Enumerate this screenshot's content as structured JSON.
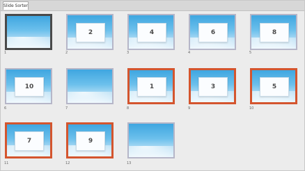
{
  "panel": {
    "tab_label": "Slide Sorter"
  },
  "slides": [
    {
      "card": "",
      "index": "1",
      "state": "selected"
    },
    {
      "card": "2",
      "index": "2",
      "state": "normal"
    },
    {
      "card": "4",
      "index": "3",
      "state": "normal"
    },
    {
      "card": "6",
      "index": "4",
      "state": "normal"
    },
    {
      "card": "8",
      "index": "5",
      "state": "normal"
    },
    {
      "card": "10",
      "index": "6",
      "state": "normal"
    },
    {
      "card": "",
      "index": "7",
      "state": "normal"
    },
    {
      "card": "1",
      "index": "8",
      "state": "highlighted"
    },
    {
      "card": "3",
      "index": "9",
      "state": "highlighted"
    },
    {
      "card": "5",
      "index": "10",
      "state": "highlighted"
    },
    {
      "card": "7",
      "index": "11",
      "state": "highlighted"
    },
    {
      "card": "9",
      "index": "12",
      "state": "highlighted"
    },
    {
      "card": "",
      "index": "13",
      "state": "normal"
    }
  ],
  "colors": {
    "selected_border": "#4a4a4a",
    "highlight_border": "#d4552e",
    "normal_border": "#b6b6c8",
    "sky_top": "#3fa6e0"
  }
}
